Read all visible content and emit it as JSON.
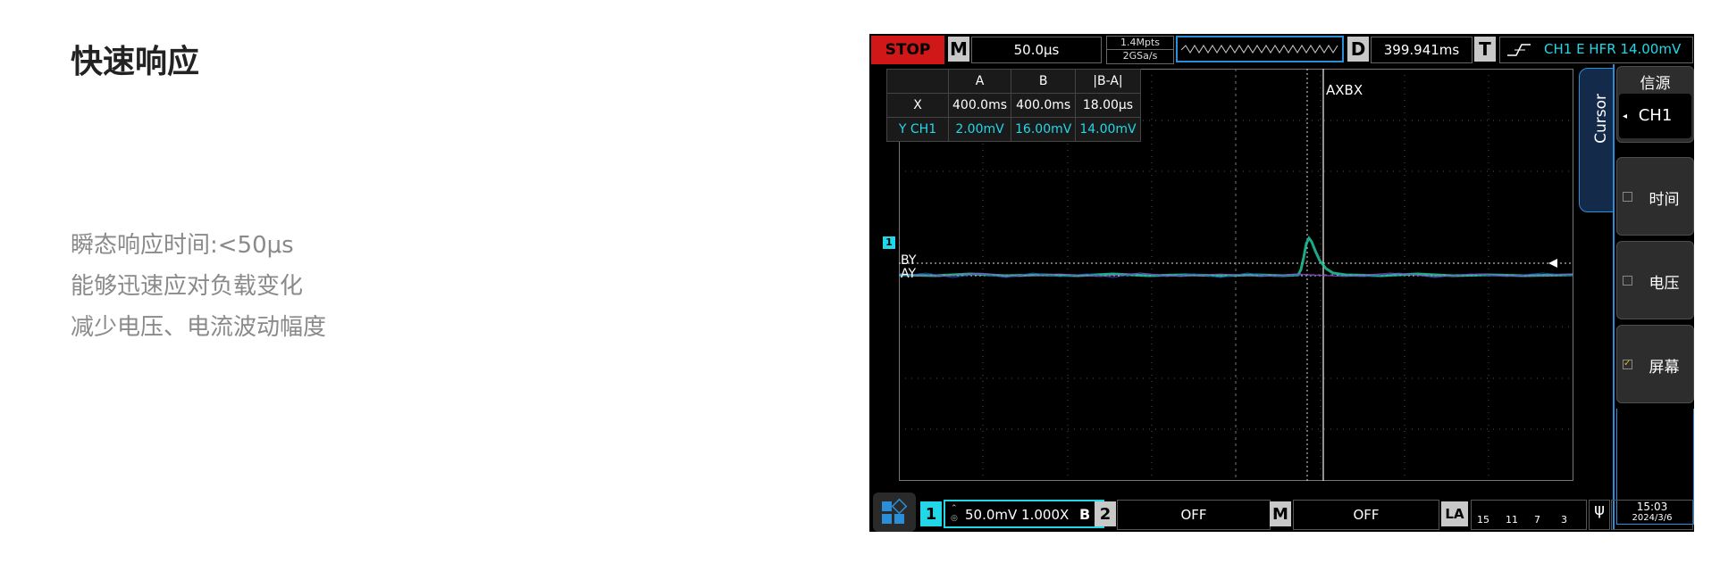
{
  "feature": {
    "title": "快速响应",
    "lines": [
      "瞬态响应时间:<50μs",
      "能够迅速应对负载变化",
      "减少电压、电流波动幅度"
    ]
  },
  "scope": {
    "run_state": "STOP",
    "timebase_letter": "M",
    "timebase_value": "50.0μs",
    "mem_depth": "1.4Mpts",
    "sample_rate": "2GSa/s",
    "delay_letter": "D",
    "delay_value": "399.941ms",
    "trigger_letter": "T",
    "trigger_text": "CH1 E HFR 14.00mV",
    "cursor_table": {
      "headers": [
        "",
        "A",
        "B",
        "|B-A|"
      ],
      "x_row": [
        "X",
        "400.0ms",
        "400.0ms",
        "18.00μs"
      ],
      "y_row": [
        "Y CH1",
        "2.00mV",
        "16.00mV",
        "14.00mV"
      ]
    },
    "cursor_labels": {
      "axbx": "AXBX",
      "by": "BY",
      "ay": "AY",
      "ch_marker": "1"
    },
    "menu": {
      "tab_label": "Cursor",
      "header": "信源",
      "source_value": "CH1",
      "item_time": "时间",
      "item_voltage": "电压",
      "item_screen": "屏幕"
    },
    "bottom": {
      "ch1_num": "1",
      "ch1_settings": "50.0mV 1.000X",
      "ch1_b": "B",
      "ch2_num": "2",
      "ch2_state": "OFF",
      "math_letter": "M",
      "math_state": "OFF",
      "la_label": "LA",
      "la_nums": [
        "15",
        "11",
        "7",
        "3"
      ],
      "time": "15:03",
      "date": "2024/3/6"
    },
    "colors": {
      "accent": "#2b8ed8",
      "ch1": "#22d8e8",
      "stop": "#d01818"
    }
  }
}
